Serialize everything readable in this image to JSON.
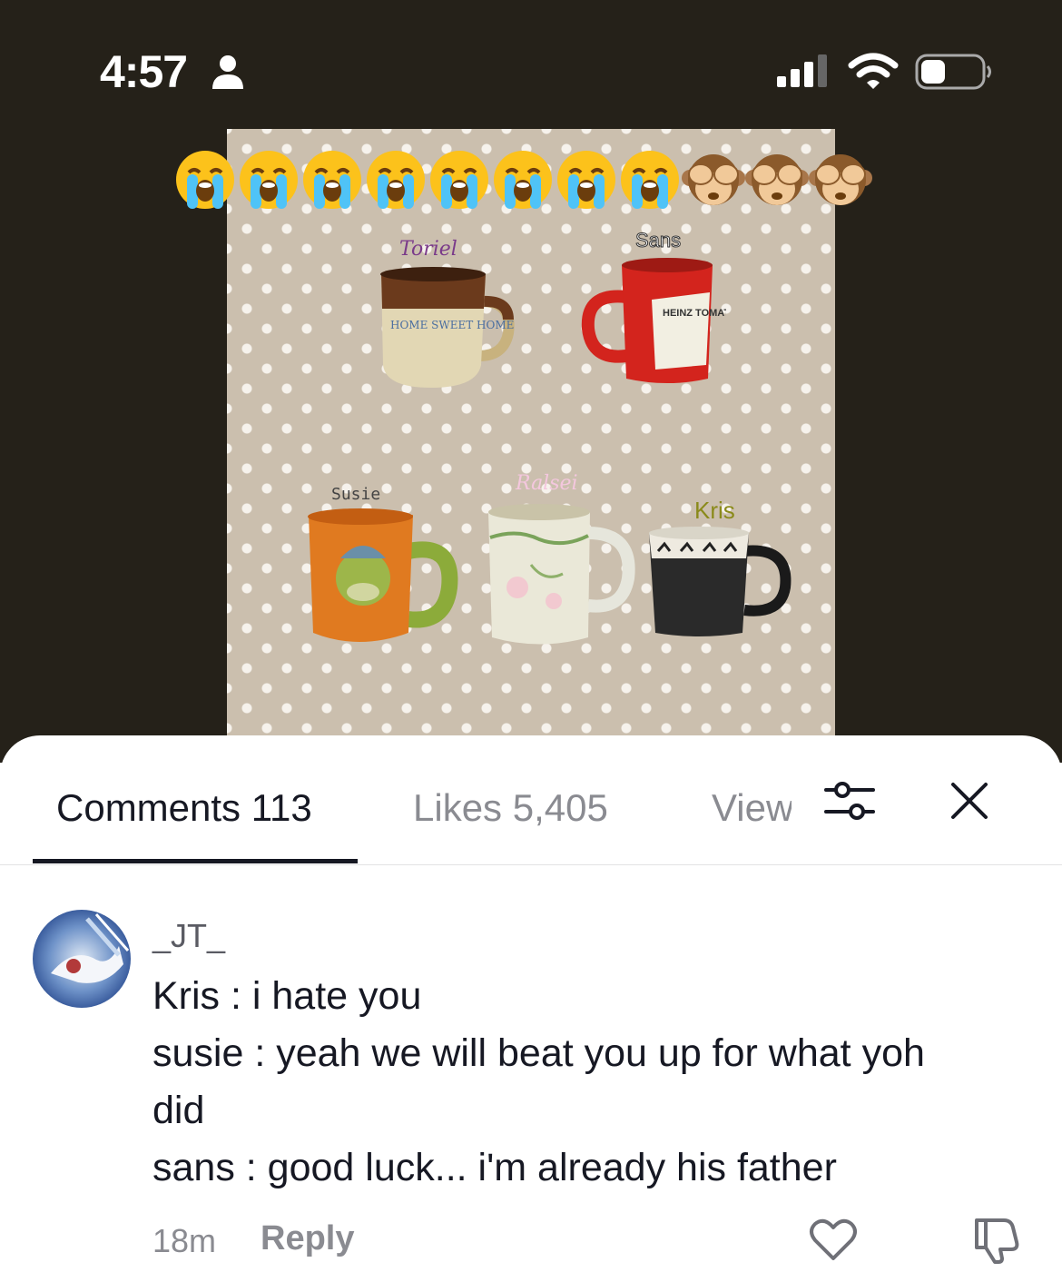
{
  "status_bar": {
    "time": "4:57",
    "icons": [
      "person-icon",
      "cellular-signal-icon",
      "wifi-icon",
      "battery-icon"
    ]
  },
  "video": {
    "emoji_overlay": [
      "loudly-crying-face",
      "loudly-crying-face",
      "loudly-crying-face",
      "loudly-crying-face",
      "loudly-crying-face",
      "loudly-crying-face",
      "loudly-crying-face",
      "loudly-crying-face",
      "see-no-evil-monkey",
      "see-no-evil-monkey",
      "see-no-evil-monkey"
    ],
    "mugs": [
      {
        "label": "Toriel",
        "mug_text": "HOME SWEET HOME",
        "label_color": "#7a3a8a"
      },
      {
        "label": "Sans",
        "mug_text": "HEINZ TOMATO KETCHUP",
        "label_color": "#ffffff"
      },
      {
        "label": "Susie",
        "label_color": "#444444"
      },
      {
        "label": "Ralsei",
        "label_color": "#f4c7de"
      },
      {
        "label": "Kris",
        "label_color": "#8a8a1a"
      }
    ]
  },
  "comments_panel": {
    "tabs": [
      {
        "label": "Comments 113",
        "active": true
      },
      {
        "label": "Likes 5,405",
        "active": false
      },
      {
        "label": "View",
        "active": false
      }
    ],
    "filter_icon": "filter-sliders-icon",
    "close_icon": "close-icon",
    "comment": {
      "username": "_JT_",
      "lines": [
        "Kris : i hate you",
        "susie : yeah we will beat you up for what yoh",
        "did",
        "sans : good luck... i'm already his father"
      ],
      "time": "18m",
      "reply_label": "Reply"
    }
  },
  "colors": {
    "top_background": "#252119",
    "panel_background": "#ffffff",
    "active_tab_text": "#161823",
    "inactive_text": "#8a8b91"
  }
}
